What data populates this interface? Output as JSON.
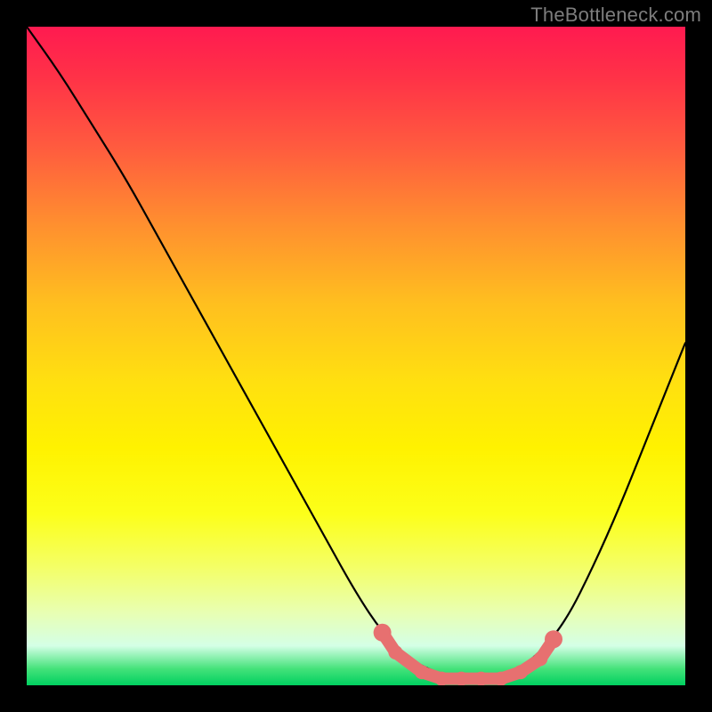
{
  "watermark": "TheBottleneck.com",
  "chart_data": {
    "type": "line",
    "title": "",
    "xlabel": "",
    "ylabel": "",
    "xlim": [
      0,
      100
    ],
    "ylim": [
      0,
      100
    ],
    "series": [
      {
        "name": "bottleneck-curve",
        "x": [
          0,
          5,
          10,
          15,
          20,
          25,
          30,
          35,
          40,
          45,
          50,
          54,
          58,
          62,
          66,
          70,
          74,
          78,
          82,
          86,
          90,
          94,
          98,
          100
        ],
        "y": [
          100,
          93,
          85,
          77,
          68,
          59,
          50,
          41,
          32,
          23,
          14,
          8,
          4,
          2,
          1,
          1,
          2,
          5,
          10,
          18,
          27,
          37,
          47,
          52
        ]
      }
    ],
    "highlight": {
      "name": "optimal-range",
      "color": "#e77070",
      "points_x": [
        54,
        56,
        60,
        63,
        66,
        69,
        72,
        75,
        78,
        80
      ],
      "points_y": [
        8,
        5,
        2,
        1,
        1,
        1,
        1,
        2,
        4,
        7
      ]
    }
  }
}
